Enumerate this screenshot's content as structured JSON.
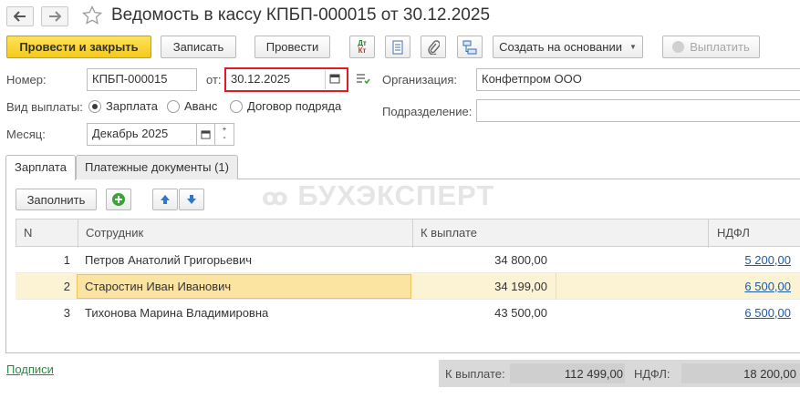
{
  "window": {
    "title": "Ведомость в кассу КПБП-000015 от 30.12.2025",
    "back_icon": "arrow-left-icon",
    "forward_icon": "arrow-right-icon",
    "favorite_icon": "star-icon"
  },
  "toolbar": {
    "post_close": "Провести и закрыть",
    "save": "Записать",
    "post": "Провести",
    "dt_kt_top": "Дт",
    "dt_kt_bottom": "Кт",
    "create_based": "Создать на основании",
    "pay": "Выплатить"
  },
  "form": {
    "number_label": "Номер:",
    "number_value": "КПБП-000015",
    "date_label": "от:",
    "date_value": "30.12.2025",
    "org_label": "Организация:",
    "org_value": "Конфетпром ООО",
    "payment_type_label": "Вид выплаты:",
    "payment_types": [
      "Зарплата",
      "Аванс",
      "Договор подряда"
    ],
    "payment_type_selected": "Зарплата",
    "division_label": "Подразделение:",
    "division_value": "",
    "month_label": "Месяц:",
    "month_value": "Декабрь 2025"
  },
  "tabs": [
    "Зарплата",
    "Платежные документы (1)"
  ],
  "table_toolbar": {
    "fill": "Заполнить"
  },
  "watermark": "БУХЭКСПЕРТ",
  "table": {
    "columns": [
      "N",
      "Сотрудник",
      "К выплате",
      "НДФЛ"
    ],
    "rows": [
      {
        "n": "1",
        "employee": "Петров Анатолий Григорьевич",
        "amount": "34 800,00",
        "ndfl": "5 200,00"
      },
      {
        "n": "2",
        "employee": "Старостин Иван Иванович",
        "amount": "34 199,00",
        "ndfl": "6 500,00"
      },
      {
        "n": "3",
        "employee": "Тихонова Марина Владимировна",
        "amount": "43 500,00",
        "ndfl": "6 500,00"
      }
    ],
    "selected_row": 2
  },
  "footer": {
    "signatures_link": "Подписи",
    "total_label": "К выплате:",
    "total_value": "112 499,00",
    "ndfl_label": "НДФЛ:",
    "ndfl_value": "18 200,00"
  },
  "colors": {
    "primary_button": "#f4c91c",
    "date_highlight": "#e01b24",
    "selected_row": "#fcf3d4",
    "link": "#1d5aa6",
    "green_add": "#3aa33a",
    "arrow_blue": "#2f78c8"
  }
}
